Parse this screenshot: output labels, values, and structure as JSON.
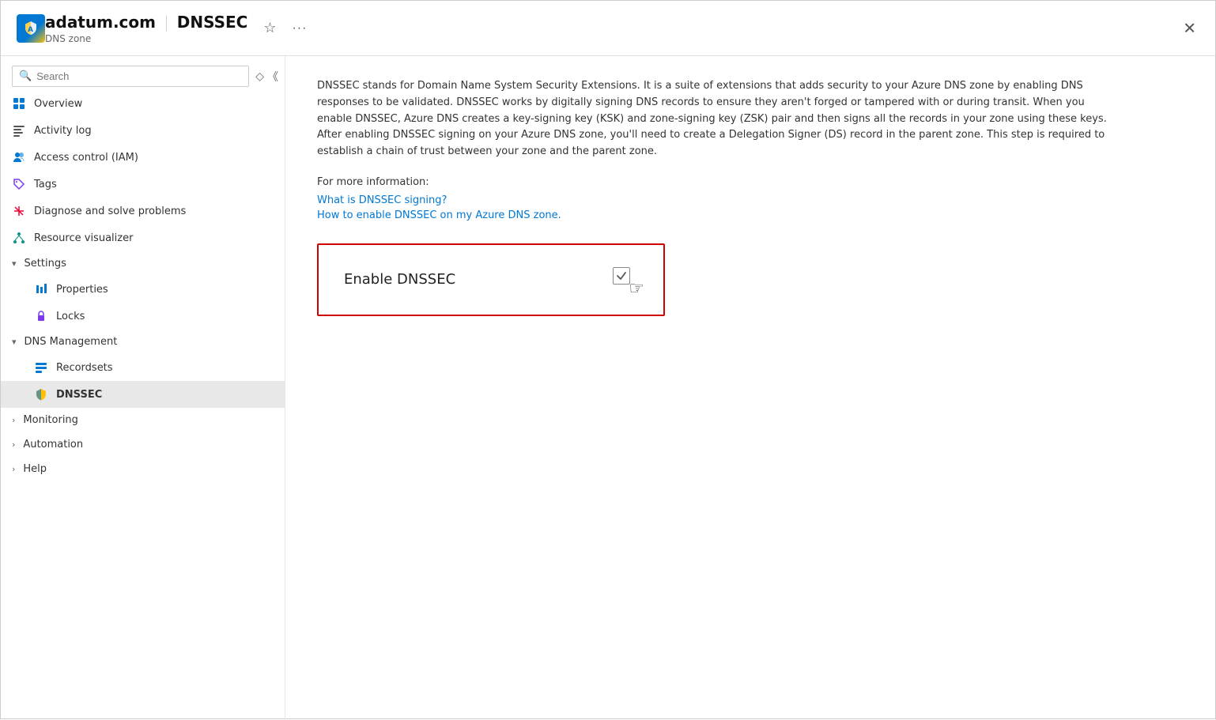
{
  "header": {
    "domain": "adatum.com",
    "separator": "|",
    "page": "DNSSEC",
    "subtitle": "DNS zone",
    "favorite_icon": "☆",
    "more_icon": "···",
    "close_icon": "✕"
  },
  "sidebar": {
    "search_placeholder": "Search",
    "nav_items": [
      {
        "id": "overview",
        "label": "Overview",
        "icon": "overview"
      },
      {
        "id": "activity-log",
        "label": "Activity log",
        "icon": "activity"
      },
      {
        "id": "access-control",
        "label": "Access control (IAM)",
        "icon": "iam"
      },
      {
        "id": "tags",
        "label": "Tags",
        "icon": "tags"
      },
      {
        "id": "diagnose",
        "label": "Diagnose and solve problems",
        "icon": "diagnose"
      },
      {
        "id": "resource-visualizer",
        "label": "Resource visualizer",
        "icon": "resource"
      }
    ],
    "sections": [
      {
        "id": "settings",
        "label": "Settings",
        "expanded": true,
        "children": [
          {
            "id": "properties",
            "label": "Properties",
            "icon": "properties"
          },
          {
            "id": "locks",
            "label": "Locks",
            "icon": "locks"
          }
        ]
      },
      {
        "id": "dns-management",
        "label": "DNS Management",
        "expanded": true,
        "children": [
          {
            "id": "recordsets",
            "label": "Recordsets",
            "icon": "recordsets"
          },
          {
            "id": "dnssec",
            "label": "DNSSEC",
            "icon": "dnssec",
            "active": true
          }
        ]
      },
      {
        "id": "monitoring",
        "label": "Monitoring",
        "expanded": false,
        "children": []
      },
      {
        "id": "automation",
        "label": "Automation",
        "expanded": false,
        "children": []
      },
      {
        "id": "help",
        "label": "Help",
        "expanded": false,
        "children": []
      }
    ]
  },
  "main": {
    "description": "DNSSEC stands for Domain Name System Security Extensions. It is a suite of extensions that adds security to your Azure DNS zone by enabling DNS responses to be validated. DNSSEC works by digitally signing DNS records to ensure they aren't forged or tampered with or during transit. When you enable DNSSEC, Azure DNS creates a key-signing key (KSK) and zone-signing key (ZSK) pair and then signs all the records in your zone using these keys. After enabling DNSSEC signing on your Azure DNS zone, you'll need to create a Delegation Signer (DS) record in the parent zone. This step is required to establish a chain of trust between your zone and the parent zone.",
    "more_info_label": "For more information:",
    "link1": "What is DNSSEC signing?",
    "link2": "How to enable DNSSEC on my Azure DNS zone.",
    "enable_label": "Enable DNSSEC"
  }
}
